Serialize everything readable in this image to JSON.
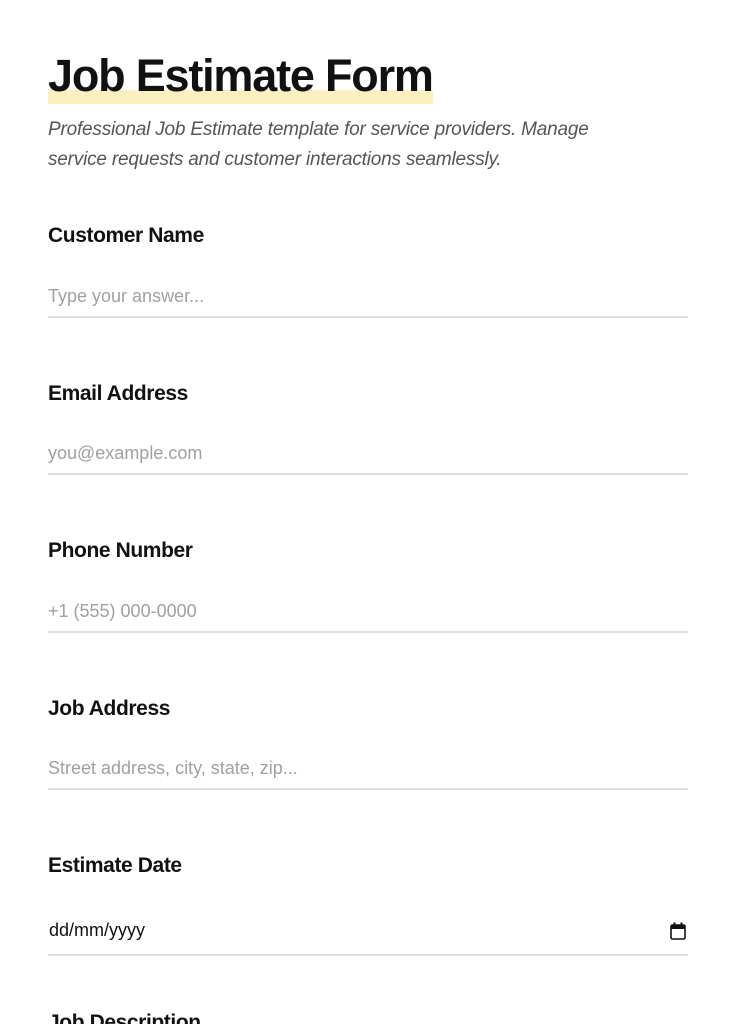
{
  "form": {
    "title": "Job Estimate Form",
    "subtitle": "Professional Job Estimate template for service providers. Manage service requests and customer interactions seamlessly.",
    "fields": [
      {
        "label": "Customer Name",
        "placeholder": "Type your answer...",
        "value": ""
      },
      {
        "label": "Email Address",
        "placeholder": "you@example.com",
        "value": ""
      },
      {
        "label": "Phone Number",
        "placeholder": "+1 (555) 000-0000",
        "value": ""
      },
      {
        "label": "Job Address",
        "placeholder": "Street address, city, state, zip...",
        "value": ""
      },
      {
        "label": "Estimate Date",
        "placeholder": "dd/mm/yyyy",
        "value": "",
        "icon": "calendar-icon"
      },
      {
        "label": "Job Description"
      }
    ]
  },
  "colors": {
    "title_highlight": "#fcefc0",
    "subtitle_text": "#555555",
    "placeholder_text": "#a0a0a0",
    "field_underline": "#dddddd"
  }
}
